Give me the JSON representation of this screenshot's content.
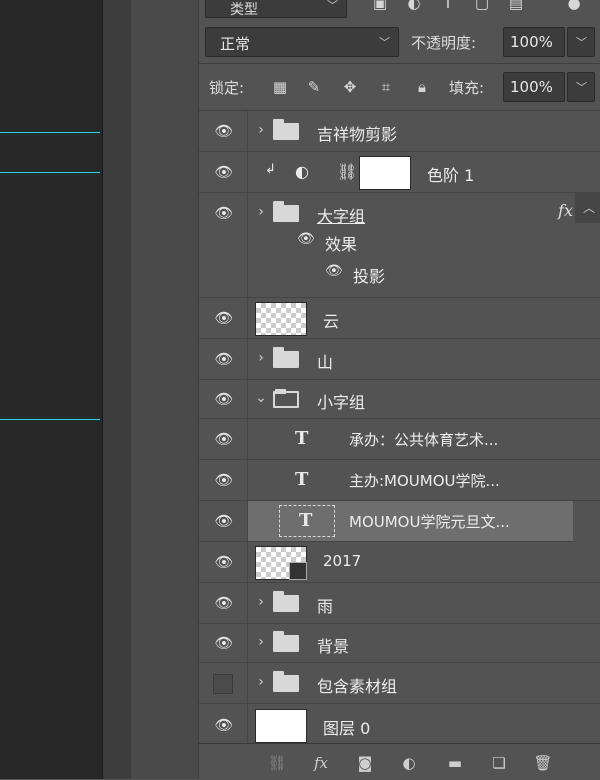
{
  "panel": {
    "kind_filter": "类型",
    "blend_mode": "正常",
    "opacity_label": "不透明度:",
    "opacity_value": "100%",
    "lock_label": "锁定:",
    "fill_label": "填充:",
    "fill_value": "100%"
  },
  "layers": [
    {
      "name": "吉祥物剪影",
      "type": "group",
      "visible": true
    },
    {
      "name": "色阶 1",
      "type": "adjustment",
      "visible": true
    },
    {
      "name": "大字组",
      "type": "group",
      "visible": true,
      "fx": "fx",
      "effects_label": "效果",
      "effect_item": "投影"
    },
    {
      "name": "云",
      "type": "pixel",
      "visible": true
    },
    {
      "name": "山",
      "type": "group",
      "visible": true
    },
    {
      "name": "小字组",
      "type": "group-open",
      "visible": true
    },
    {
      "name": "承办：公共体育艺术...",
      "type": "text",
      "visible": true
    },
    {
      "name": "主办:MOUMOU学院...",
      "type": "text",
      "visible": true
    },
    {
      "name": "MOUMOU学院元旦文...",
      "type": "text",
      "visible": true,
      "selected": true
    },
    {
      "name": "2017",
      "type": "smart",
      "visible": true
    },
    {
      "name": "雨",
      "type": "group",
      "visible": true
    },
    {
      "name": "背景",
      "type": "group",
      "visible": true
    },
    {
      "name": "包含素材组",
      "type": "group",
      "visible": false
    },
    {
      "name": "图层 0",
      "type": "pixel-white",
      "visible": true
    }
  ],
  "icons": {
    "eye": "eye-icon",
    "folder": "folder-icon",
    "text": "text-layer-icon",
    "link": "link-icon",
    "fx": "fx-icon",
    "mask": "mask-icon",
    "adjust": "adjustment-icon",
    "new_group": "new-group-icon",
    "new_layer": "new-layer-icon",
    "trash": "trash-icon"
  },
  "colors": {
    "guide": "#2bd6e6",
    "selected_row": "#6e6e6e"
  }
}
